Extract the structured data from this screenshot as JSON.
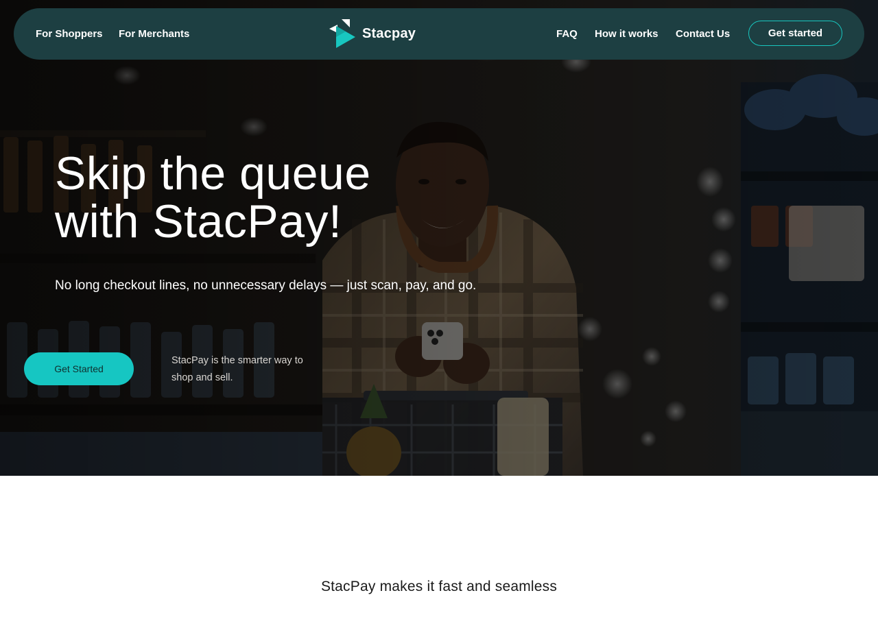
{
  "nav": {
    "links_left": [
      "For Shoppers",
      "For Merchants"
    ],
    "brand": "Stacpay",
    "links_right": [
      "FAQ",
      "How it works",
      "Contact Us"
    ],
    "cta": "Get started"
  },
  "hero": {
    "title_lines": [
      "Skip the queue",
      "with StacPay!"
    ],
    "subtitle": "No long checkout lines, no unnecessary delays — just scan, pay, and go.",
    "cta": "Get Started",
    "tagline_lines": [
      "StacPay is the smarter way to",
      "shop and sell."
    ]
  },
  "section": {
    "heading": "StacPay makes it fast and seamless"
  },
  "colors": {
    "nav_bg": "#1d3f42",
    "accent": "#16c6c2",
    "hero_overlay": "#1c1a18"
  },
  "icons": {
    "logo": "stacpay-logo-icon"
  }
}
